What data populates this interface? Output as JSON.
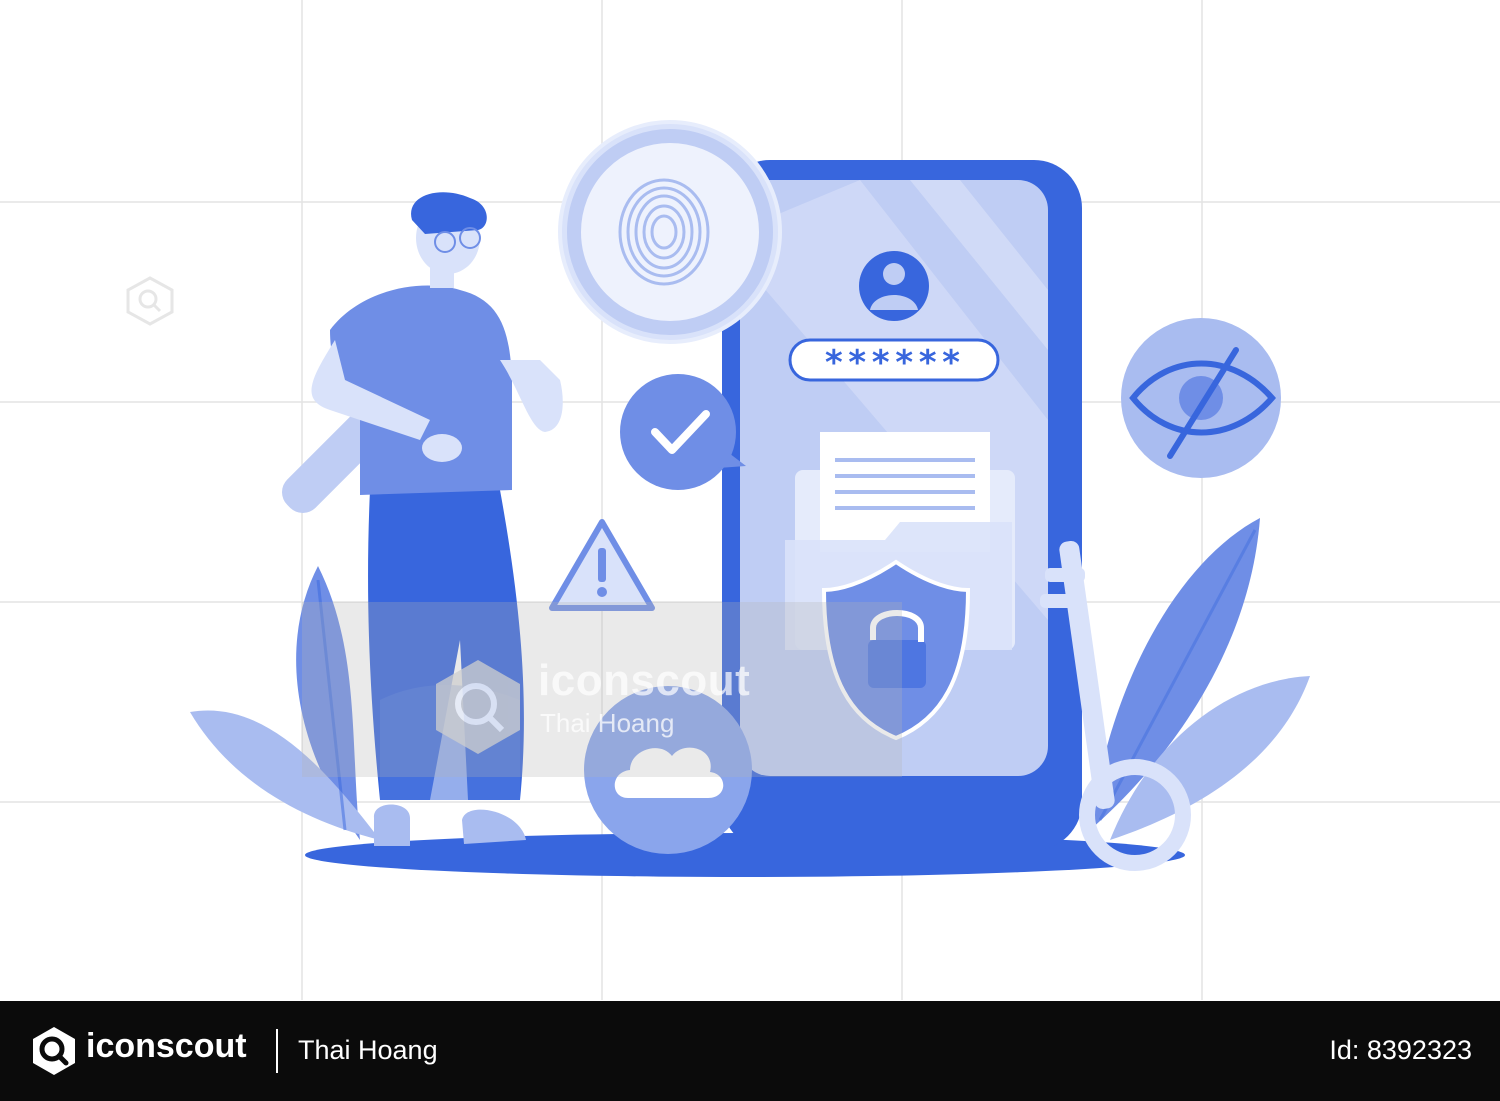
{
  "illustration": {
    "password_mask": "******",
    "colors": {
      "primary": "#3866dd",
      "mid": "#6f8ee6",
      "light": "#a9bcf0",
      "pale": "#d9e2fa",
      "background": "#ffffff"
    }
  },
  "watermark": {
    "brand": "iconscout",
    "author": "Thai Hoang"
  },
  "footer": {
    "brand": "iconscout",
    "author": "Thai Hoang",
    "id_text": "Id: 8392323"
  }
}
